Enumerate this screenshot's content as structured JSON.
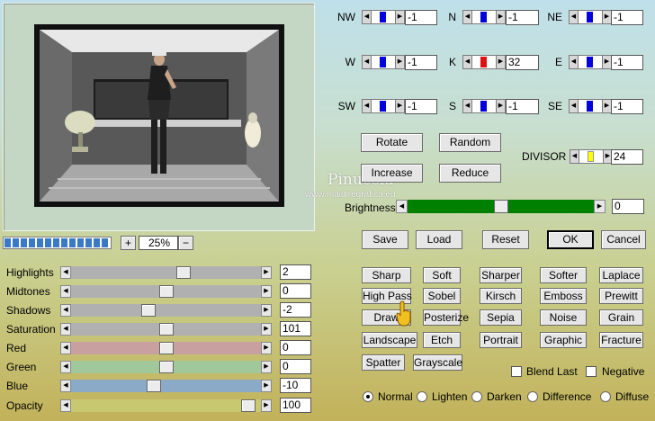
{
  "colors": {
    "blue_thumb": "#0000dd",
    "red_thumb": "#e01010",
    "yellow_thumb": "#ffff00",
    "brightness_track": "#008000",
    "progress": "#3a78c8",
    "red_channel": "#c8a0a0",
    "green_channel": "#a0c89a",
    "blue_channel": "#8aaac8",
    "opacity_channel": "#c8c870"
  },
  "preview": {
    "watermark_line1": "Pinuccia",
    "watermark_line2": "www.maidiregrafica.eu",
    "progress_level": 1.0
  },
  "zoom": {
    "plus": "+",
    "minus": "−",
    "value": "25%"
  },
  "kernel": [
    {
      "label": "NW",
      "value": "-1"
    },
    {
      "label": "N",
      "value": "-1"
    },
    {
      "label": "NE",
      "value": "-1"
    },
    {
      "label": "W",
      "value": "-1"
    },
    {
      "label": "K",
      "value": "32"
    },
    {
      "label": "E",
      "value": "-1"
    },
    {
      "label": "SW",
      "value": "-1"
    },
    {
      "label": "S",
      "value": "-1"
    },
    {
      "label": "SE",
      "value": "-1"
    }
  ],
  "buttons": {
    "rotate": "Rotate",
    "random": "Random",
    "increase": "Increase",
    "reduce": "Reduce",
    "save": "Save",
    "load": "Load",
    "reset": "Reset",
    "ok": "OK",
    "cancel": "Cancel"
  },
  "divisor": {
    "label": "DIVISOR",
    "value": "24"
  },
  "brightness": {
    "label": "Brightness",
    "value": "0",
    "level": 0.5
  },
  "adjust": [
    {
      "label": "Highlights",
      "value": "2",
      "level": 0.6
    },
    {
      "label": "Midtones",
      "value": "0",
      "level": 0.5
    },
    {
      "label": "Shadows",
      "value": "-2",
      "level": 0.4
    },
    {
      "label": "Saturation",
      "value": "101",
      "level": 0.5
    },
    {
      "label": "Red",
      "value": "0",
      "level": 0.5
    },
    {
      "label": "Green",
      "value": "0",
      "level": 0.5
    },
    {
      "label": "Blue",
      "value": "-10",
      "level": 0.43
    },
    {
      "label": "Opacity",
      "value": "100",
      "level": 0.97
    }
  ],
  "presets": [
    [
      "Sharp",
      "Soft",
      "Sharper",
      "Softer",
      "Laplace"
    ],
    [
      "High Pass",
      "Sobel",
      "Kirsch",
      "Emboss",
      "Prewitt"
    ],
    [
      "Draw",
      "Posterize",
      "Sepia",
      "Noise",
      "Grain"
    ],
    [
      "Landscape",
      "Etch",
      "Portrait",
      "Graphic",
      "Fracture"
    ],
    [
      "Spatter",
      "Grayscale"
    ]
  ],
  "checks": {
    "blend_last": "Blend Last",
    "negative": "Negative"
  },
  "modes": [
    "Normal",
    "Lighten",
    "Darken",
    "Difference",
    "Diffuse"
  ],
  "selected_mode": "Normal"
}
